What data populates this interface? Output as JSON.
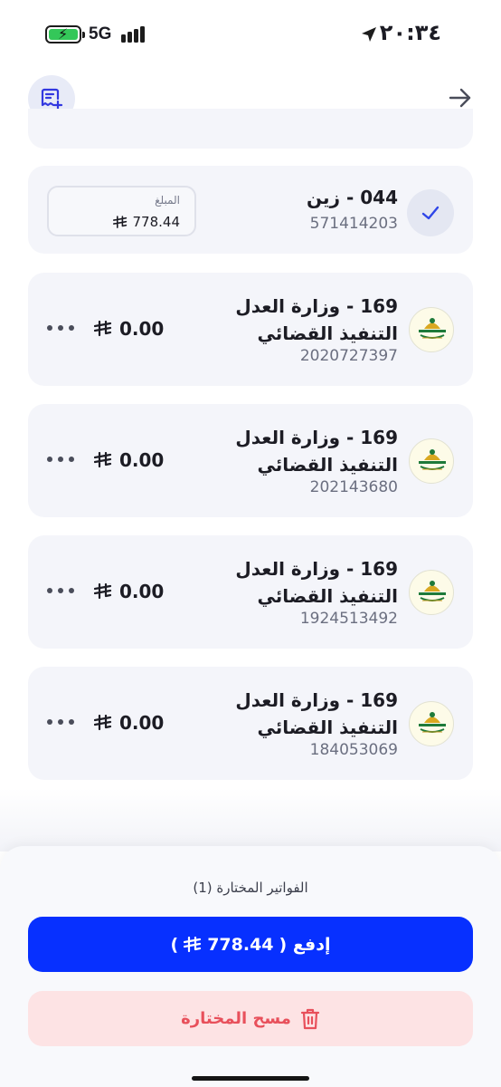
{
  "status_bar": {
    "time": "٢٠:٣٤",
    "network": "5G",
    "icons": [
      "battery-charging-icon",
      "signal-icon",
      "location-arrow-icon"
    ]
  },
  "header": {
    "left_icon": "add-bill-icon",
    "right_icon": "arrow-right-icon"
  },
  "selected_bill": {
    "title": "044 - زين",
    "number": "571414203",
    "amount_label": "المبلغ",
    "amount": "778.44",
    "checked": true
  },
  "bills": [
    {
      "title": "169 - وزارة العدل التنفيذ القضائي",
      "number": "2020727397",
      "amount": "0.00"
    },
    {
      "title": "169 - وزارة العدل التنفيذ القضائي",
      "number": "202143680",
      "amount": "0.00"
    },
    {
      "title": "169 - وزارة العدل التنفيذ القضائي",
      "number": "1924513492",
      "amount": "0.00"
    },
    {
      "title": "169 - وزارة العدل التنفيذ القضائي",
      "number": "184053069",
      "amount": "0.00"
    }
  ],
  "footer": {
    "selected_label": "الفواتير المختارة (1)",
    "pay_label_prefix": "إدفع (",
    "pay_amount": "778.44",
    "pay_label_suffix": ")",
    "clear_label": "مسح المختارة"
  },
  "colors": {
    "accent": "#0730ff",
    "danger": "#e8505b",
    "danger_bg": "#fde3e4",
    "card_bg": "#f4f5fa"
  }
}
